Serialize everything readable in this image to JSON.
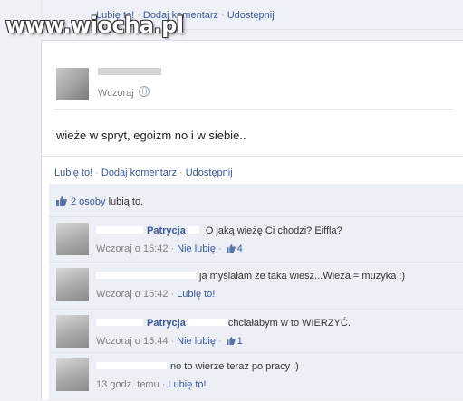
{
  "watermark": "www.wiocha.pl",
  "top_actions": {
    "like": "Lubię to!",
    "comment": "Dodaj komentarz",
    "share": "Udostępnij"
  },
  "post": {
    "timestamp": "Wczoraj",
    "text": "wieże w spryt, egoizm no i w siebie..",
    "actions": {
      "like": "Lubię to!",
      "comment": "Dodaj komentarz",
      "share": "Udostępnij"
    },
    "likes_link": "2 osoby",
    "likes_suffix": "lubią to."
  },
  "comments": [
    {
      "name": "Patrycja",
      "text": "O jaką wieżę Ci chodzi? Eiffla?",
      "time": "Wczoraj o 15:42",
      "action": "Nie lubię",
      "likes": "4"
    },
    {
      "name": "",
      "text": "ja myślałam że taka wiesz...Wieża = muzyka :)",
      "time": "Wczoraj o 15:42",
      "action": "Lubię to!",
      "likes": ""
    },
    {
      "name": "Patrycja",
      "text": "chciałabym w to WIERZYĆ.",
      "time": "Wczoraj o 15:44",
      "action": "Nie lubię",
      "likes": "1"
    },
    {
      "name": "",
      "text": "no to wierze teraz po pracy :)",
      "time": "13 godz. temu",
      "action": "Lubię to!",
      "likes": ""
    }
  ]
}
